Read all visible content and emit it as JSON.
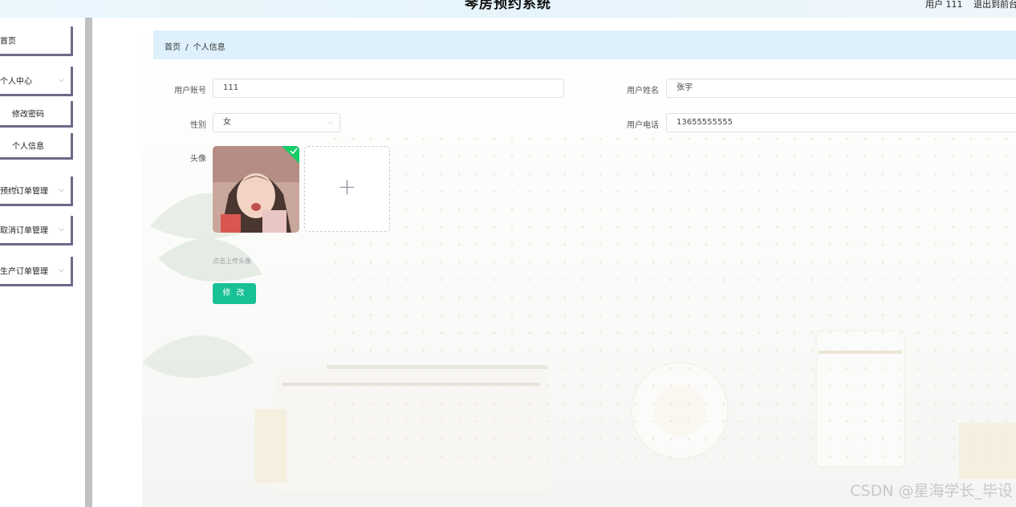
{
  "header": {
    "title": "琴房预约系统",
    "user_label": "用户 111",
    "logout_label": "退出到前台"
  },
  "sidebar": {
    "items": [
      {
        "label": "首页",
        "has_chevron": false
      },
      {
        "label": "个人中心",
        "has_chevron": true
      },
      {
        "label": "修改密码",
        "has_chevron": false
      },
      {
        "label": "个人信息",
        "has_chevron": false
      },
      {
        "label": "预约订单管理",
        "has_chevron": true
      },
      {
        "label": "取消订单管理",
        "has_chevron": true
      },
      {
        "label": "生产订单管理",
        "has_chevron": true
      }
    ]
  },
  "breadcrumb": {
    "home": "首页",
    "separator": "/",
    "current": "个人信息"
  },
  "form": {
    "account_label": "用户账号",
    "account_value": "111",
    "name_label": "用户姓名",
    "name_value": "张宇",
    "gender_label": "性别",
    "gender_value": "女",
    "phone_label": "用户电话",
    "phone_value": "13655555555",
    "avatar_label": "头像",
    "upload_hint": "点击上传头像",
    "submit_label": "修 改"
  },
  "icons": {
    "chevron": "chevron-down-icon",
    "plus": "plus-icon",
    "success": "check-icon"
  },
  "colors": {
    "accent": "#18c195",
    "breadcrumb_bg": "#ddf0fb",
    "menu_border": "#6d6a88"
  },
  "watermark": "CSDN @星海学长_毕设"
}
